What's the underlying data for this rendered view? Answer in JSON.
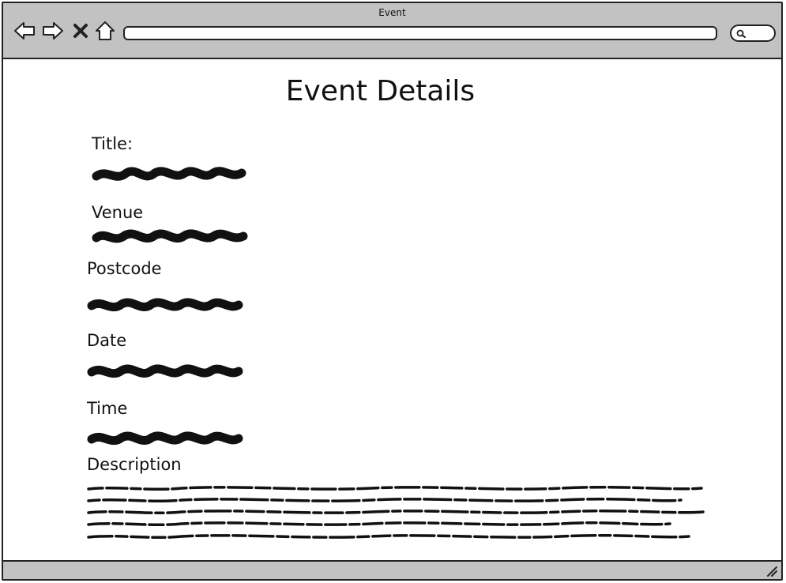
{
  "window": {
    "title": "Event"
  },
  "nav_icons": [
    "back-arrow-icon",
    "forward-arrow-icon",
    "close-x-icon",
    "home-icon"
  ],
  "address_bar": {
    "value": ""
  },
  "search": {
    "icon": "search-icon"
  },
  "page": {
    "heading": "Event Details",
    "fields": [
      {
        "label": "Title:"
      },
      {
        "label": "Venue"
      },
      {
        "label": "Postcode"
      },
      {
        "label": "Date"
      },
      {
        "label": "Time"
      },
      {
        "label": "Description"
      }
    ]
  },
  "colors": {
    "chrome": "#c2c2c2",
    "ink": "#111111",
    "background": "#ffffff"
  }
}
